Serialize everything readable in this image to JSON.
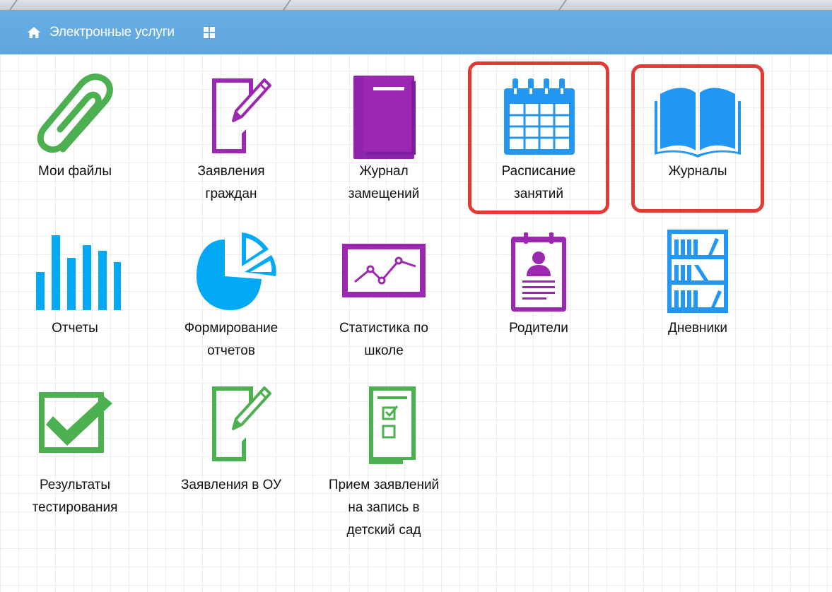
{
  "header": {
    "title": "Электронные услуги",
    "home_icon": "home-icon",
    "apps_icon": "grid-icon",
    "color": "#62aae2"
  },
  "tiles": [
    {
      "label": "Мои файлы",
      "icon": "paperclip-icon",
      "color": "#4caf50"
    },
    {
      "label": "Заявления граждан",
      "icon": "document-pencil-icon",
      "color": "#9c27b0"
    },
    {
      "label": "Журнал замещений",
      "icon": "book-icon",
      "color": "#9c27b0"
    },
    {
      "label": "Расписание занятий",
      "icon": "calendar-icon",
      "color": "#2196f3",
      "highlighted": true
    },
    {
      "label": "Журналы",
      "icon": "open-book-icon",
      "color": "#2196f3",
      "highlighted": true
    },
    {
      "label": "Отчеты",
      "icon": "bar-chart-icon",
      "color": "#03a9f4"
    },
    {
      "label": "Формирование отчетов",
      "icon": "pie-chart-icon",
      "color": "#03a9f4"
    },
    {
      "label": "Статистика по школе",
      "icon": "line-chart-icon",
      "color": "#9c27b0"
    },
    {
      "label": "Родители",
      "icon": "profile-card-icon",
      "color": "#9c27b0"
    },
    {
      "label": "Дневники",
      "icon": "bookshelf-icon",
      "color": "#2196f3"
    },
    {
      "label": "Результаты тестирования",
      "icon": "checkbox-icon",
      "color": "#4caf50"
    },
    {
      "label": "Заявления в ОУ",
      "icon": "document-pencil-icon",
      "color": "#4caf50"
    },
    {
      "label": "Прием заявлений на запись в детский сад",
      "icon": "checklist-icon",
      "color": "#4caf50"
    }
  ],
  "highlight_color": "#e03a33"
}
